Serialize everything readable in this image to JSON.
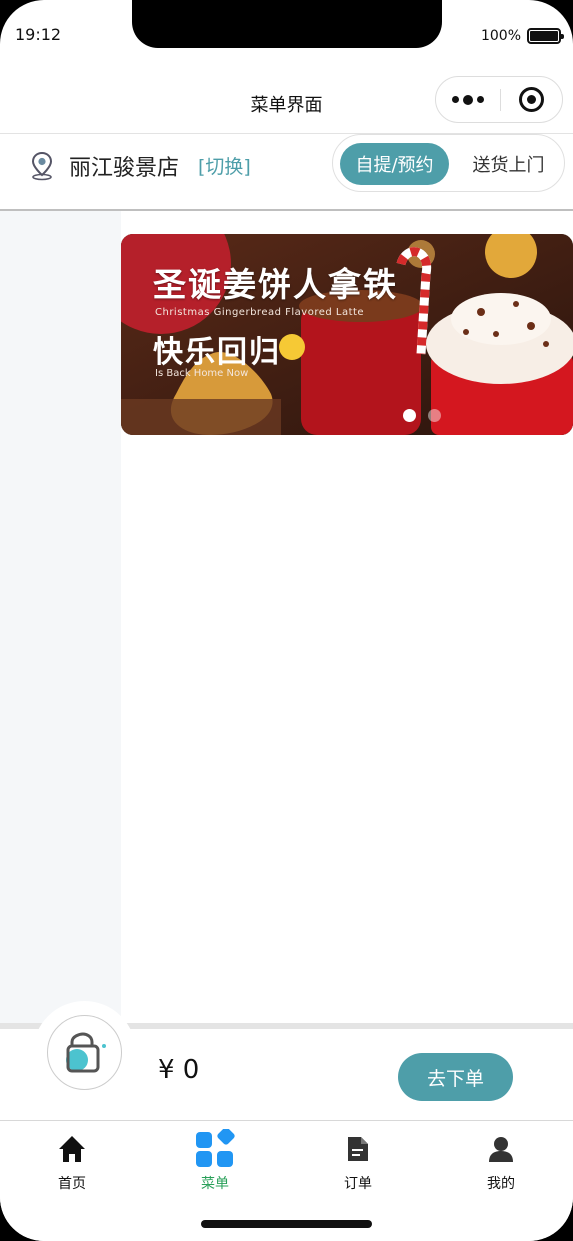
{
  "status_bar": {
    "time": "19:12",
    "battery": "100%"
  },
  "nav": {
    "title": "菜单界面"
  },
  "store": {
    "name": "丽江骏景店",
    "switch_label": "[切换]"
  },
  "mode_toggle": {
    "active": "自提/预约",
    "inactive": "送货上门"
  },
  "banner": {
    "title": "圣诞姜饼人拿铁",
    "subtitle": "Christmas Gingerbread Flavored Latte",
    "title2": "快乐回归",
    "subtitle2": "Is Back Home Now",
    "active_slide": 1,
    "slide_count": 2
  },
  "cart": {
    "total": "¥ 0",
    "order_label": "去下单"
  },
  "tabs": [
    {
      "label": "首页",
      "icon": "home-icon",
      "active": false
    },
    {
      "label": "菜单",
      "icon": "menu-grid-icon",
      "active": true
    },
    {
      "label": "订单",
      "icon": "order-document-icon",
      "active": false
    },
    {
      "label": "我的",
      "icon": "user-icon",
      "active": false
    }
  ],
  "colors": {
    "accent": "#4e9ea9",
    "tab_active": "#2aa05a",
    "sidebar": "#f5f7f9",
    "menu_icon_blue": "#2196f3"
  }
}
